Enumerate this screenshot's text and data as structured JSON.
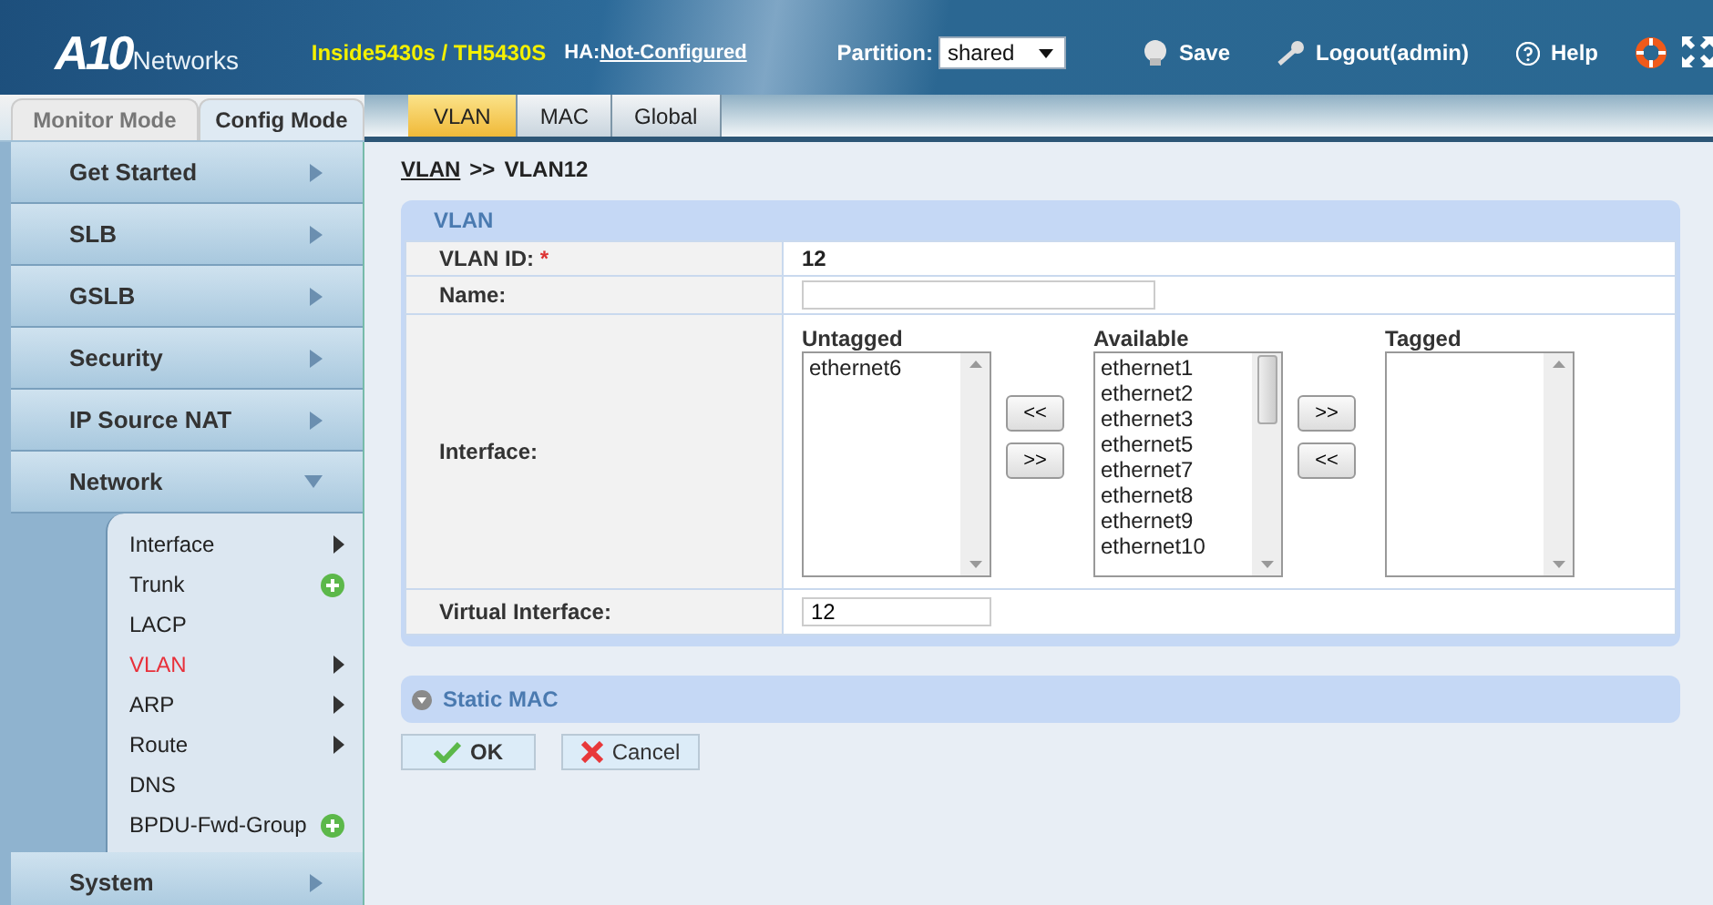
{
  "header": {
    "logo": {
      "mark": "A10",
      "word": "Networks"
    },
    "device": "Inside5430s / TH5430S",
    "ha_label": "HA:",
    "ha_status": "Not-Configured",
    "partition": {
      "label": "Partition:",
      "value": "shared"
    },
    "actions": [
      {
        "kind": "save",
        "label": "Save"
      },
      {
        "kind": "logout",
        "label": "Logout(admin)"
      },
      {
        "kind": "help",
        "label": "Help"
      }
    ]
  },
  "mode_tabs": [
    {
      "label": "Monitor Mode",
      "selected": false
    },
    {
      "label": "Config Mode",
      "selected": true
    }
  ],
  "subtabs": [
    {
      "label": "VLAN",
      "selected": true
    },
    {
      "label": "MAC",
      "selected": false
    },
    {
      "label": "Global",
      "selected": false
    }
  ],
  "sidebar": {
    "items": [
      {
        "label": "Get Started",
        "expanded": false
      },
      {
        "label": "SLB",
        "expanded": false
      },
      {
        "label": "GSLB",
        "expanded": false
      },
      {
        "label": "Security",
        "expanded": false
      },
      {
        "label": "IP Source NAT",
        "expanded": false
      },
      {
        "label": "Network",
        "expanded": true,
        "children": [
          {
            "label": "Interface",
            "kind": "submenu",
            "selected": false
          },
          {
            "label": "Trunk",
            "kind": "add",
            "selected": false
          },
          {
            "label": "LACP",
            "kind": "plain",
            "selected": false
          },
          {
            "label": "VLAN",
            "kind": "submenu",
            "selected": true
          },
          {
            "label": "ARP",
            "kind": "submenu",
            "selected": false
          },
          {
            "label": "Route",
            "kind": "submenu",
            "selected": false
          },
          {
            "label": "DNS",
            "kind": "plain",
            "selected": false
          },
          {
            "label": "BPDU-Fwd-Group",
            "kind": "add",
            "selected": false
          }
        ]
      },
      {
        "label": "System",
        "expanded": false
      }
    ]
  },
  "breadcrumb": {
    "link": "VLAN",
    "separator": ">>",
    "current": "VLAN12"
  },
  "panel": {
    "title": "VLAN",
    "vlan_id": {
      "label": "VLAN ID:",
      "required": "*",
      "value": "12"
    },
    "name": {
      "label": "Name:"
    },
    "interface": {
      "label": "Interface:",
      "untagged": {
        "title": "Untagged",
        "items": [
          "ethernet6"
        ]
      },
      "available": {
        "title": "Available",
        "items": [
          "ethernet1",
          "ethernet2",
          "ethernet3",
          "ethernet5",
          "ethernet7",
          "ethernet8",
          "ethernet9",
          "ethernet10"
        ]
      },
      "tagged": {
        "title": "Tagged"
      },
      "left_buttons": [
        "<<",
        ">>"
      ],
      "right_buttons": [
        ">>",
        "<<"
      ]
    },
    "virtual_interface": {
      "label": "Virtual Interface:",
      "value": "12"
    }
  },
  "static_mac": {
    "title": "Static MAC",
    "expanded": false
  },
  "buttons": [
    {
      "kind": "ok",
      "label": "OK"
    },
    {
      "kind": "cancel",
      "label": "Cancel"
    }
  ]
}
